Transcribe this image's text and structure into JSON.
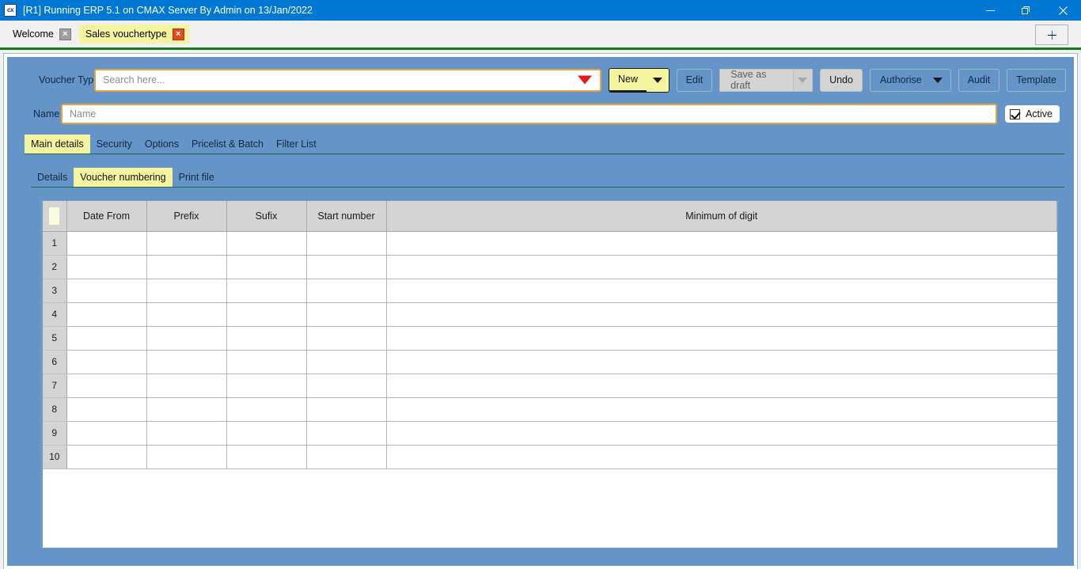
{
  "window": {
    "title": "[R1] Running ERP 5.1 on CMAX Server By Admin on 13/Jan/2022",
    "app_icon": "cx",
    "minimize_icon": "minimize-icon",
    "maximize_icon": "restore-icon",
    "close_icon": "close-icon"
  },
  "doc_tabs": {
    "items": [
      {
        "label": "Welcome",
        "active": false,
        "close": "×"
      },
      {
        "label": "Sales vouchertype",
        "active": true,
        "close": "×"
      }
    ],
    "add_tab": "+"
  },
  "form": {
    "voucher_type_label": "Voucher Type",
    "voucher_type_placeholder": "Search here...",
    "voucher_type_value": "",
    "name_label": "Name",
    "name_placeholder": "Name",
    "name_value": "",
    "active_label": "Active",
    "active_checked": true
  },
  "toolbar": {
    "new_label": "New",
    "edit_label": "Edit",
    "save_as_draft_label": "Save as draft",
    "undo_label": "Undo",
    "authorise_label": "Authorise",
    "audit_label": "Audit",
    "template_label": "Template"
  },
  "tabs_main": [
    {
      "label": "Main details",
      "selected": true
    },
    {
      "label": "Security",
      "selected": false
    },
    {
      "label": "Options",
      "selected": false
    },
    {
      "label": "Pricelist & Batch",
      "selected": false
    },
    {
      "label": "Filter List",
      "selected": false
    }
  ],
  "tabs_sub": [
    {
      "label": "Details",
      "selected": false
    },
    {
      "label": "Voucher numbering",
      "selected": true
    },
    {
      "label": "Print file",
      "selected": false
    }
  ],
  "grid": {
    "columns": [
      "",
      "Date From",
      "Prefix",
      "Sufix",
      "Start number",
      "Minimum of digit"
    ],
    "rows": [
      {
        "n": "1",
        "date_from": "",
        "prefix": "",
        "sufix": "",
        "start_number": "",
        "minimum_of_digit": ""
      },
      {
        "n": "2",
        "date_from": "",
        "prefix": "",
        "sufix": "",
        "start_number": "",
        "minimum_of_digit": ""
      },
      {
        "n": "3",
        "date_from": "",
        "prefix": "",
        "sufix": "",
        "start_number": "",
        "minimum_of_digit": ""
      },
      {
        "n": "4",
        "date_from": "",
        "prefix": "",
        "sufix": "",
        "start_number": "",
        "minimum_of_digit": ""
      },
      {
        "n": "5",
        "date_from": "",
        "prefix": "",
        "sufix": "",
        "start_number": "",
        "minimum_of_digit": ""
      },
      {
        "n": "6",
        "date_from": "",
        "prefix": "",
        "sufix": "",
        "start_number": "",
        "minimum_of_digit": ""
      },
      {
        "n": "7",
        "date_from": "",
        "prefix": "",
        "sufix": "",
        "start_number": "",
        "minimum_of_digit": ""
      },
      {
        "n": "8",
        "date_from": "",
        "prefix": "",
        "sufix": "",
        "start_number": "",
        "minimum_of_digit": ""
      },
      {
        "n": "9",
        "date_from": "",
        "prefix": "",
        "sufix": "",
        "start_number": "",
        "minimum_of_digit": ""
      },
      {
        "n": "10",
        "date_from": "",
        "prefix": "",
        "sufix": "",
        "start_number": "",
        "minimum_of_digit": ""
      }
    ]
  },
  "colors": {
    "titlebar": "#0078d4",
    "panel": "#6494c8",
    "accent_yellow": "#f5f5a0",
    "focus_border": "#e8a33d",
    "separator_green": "#157a15",
    "dropdown_red": "#e01b1b"
  }
}
